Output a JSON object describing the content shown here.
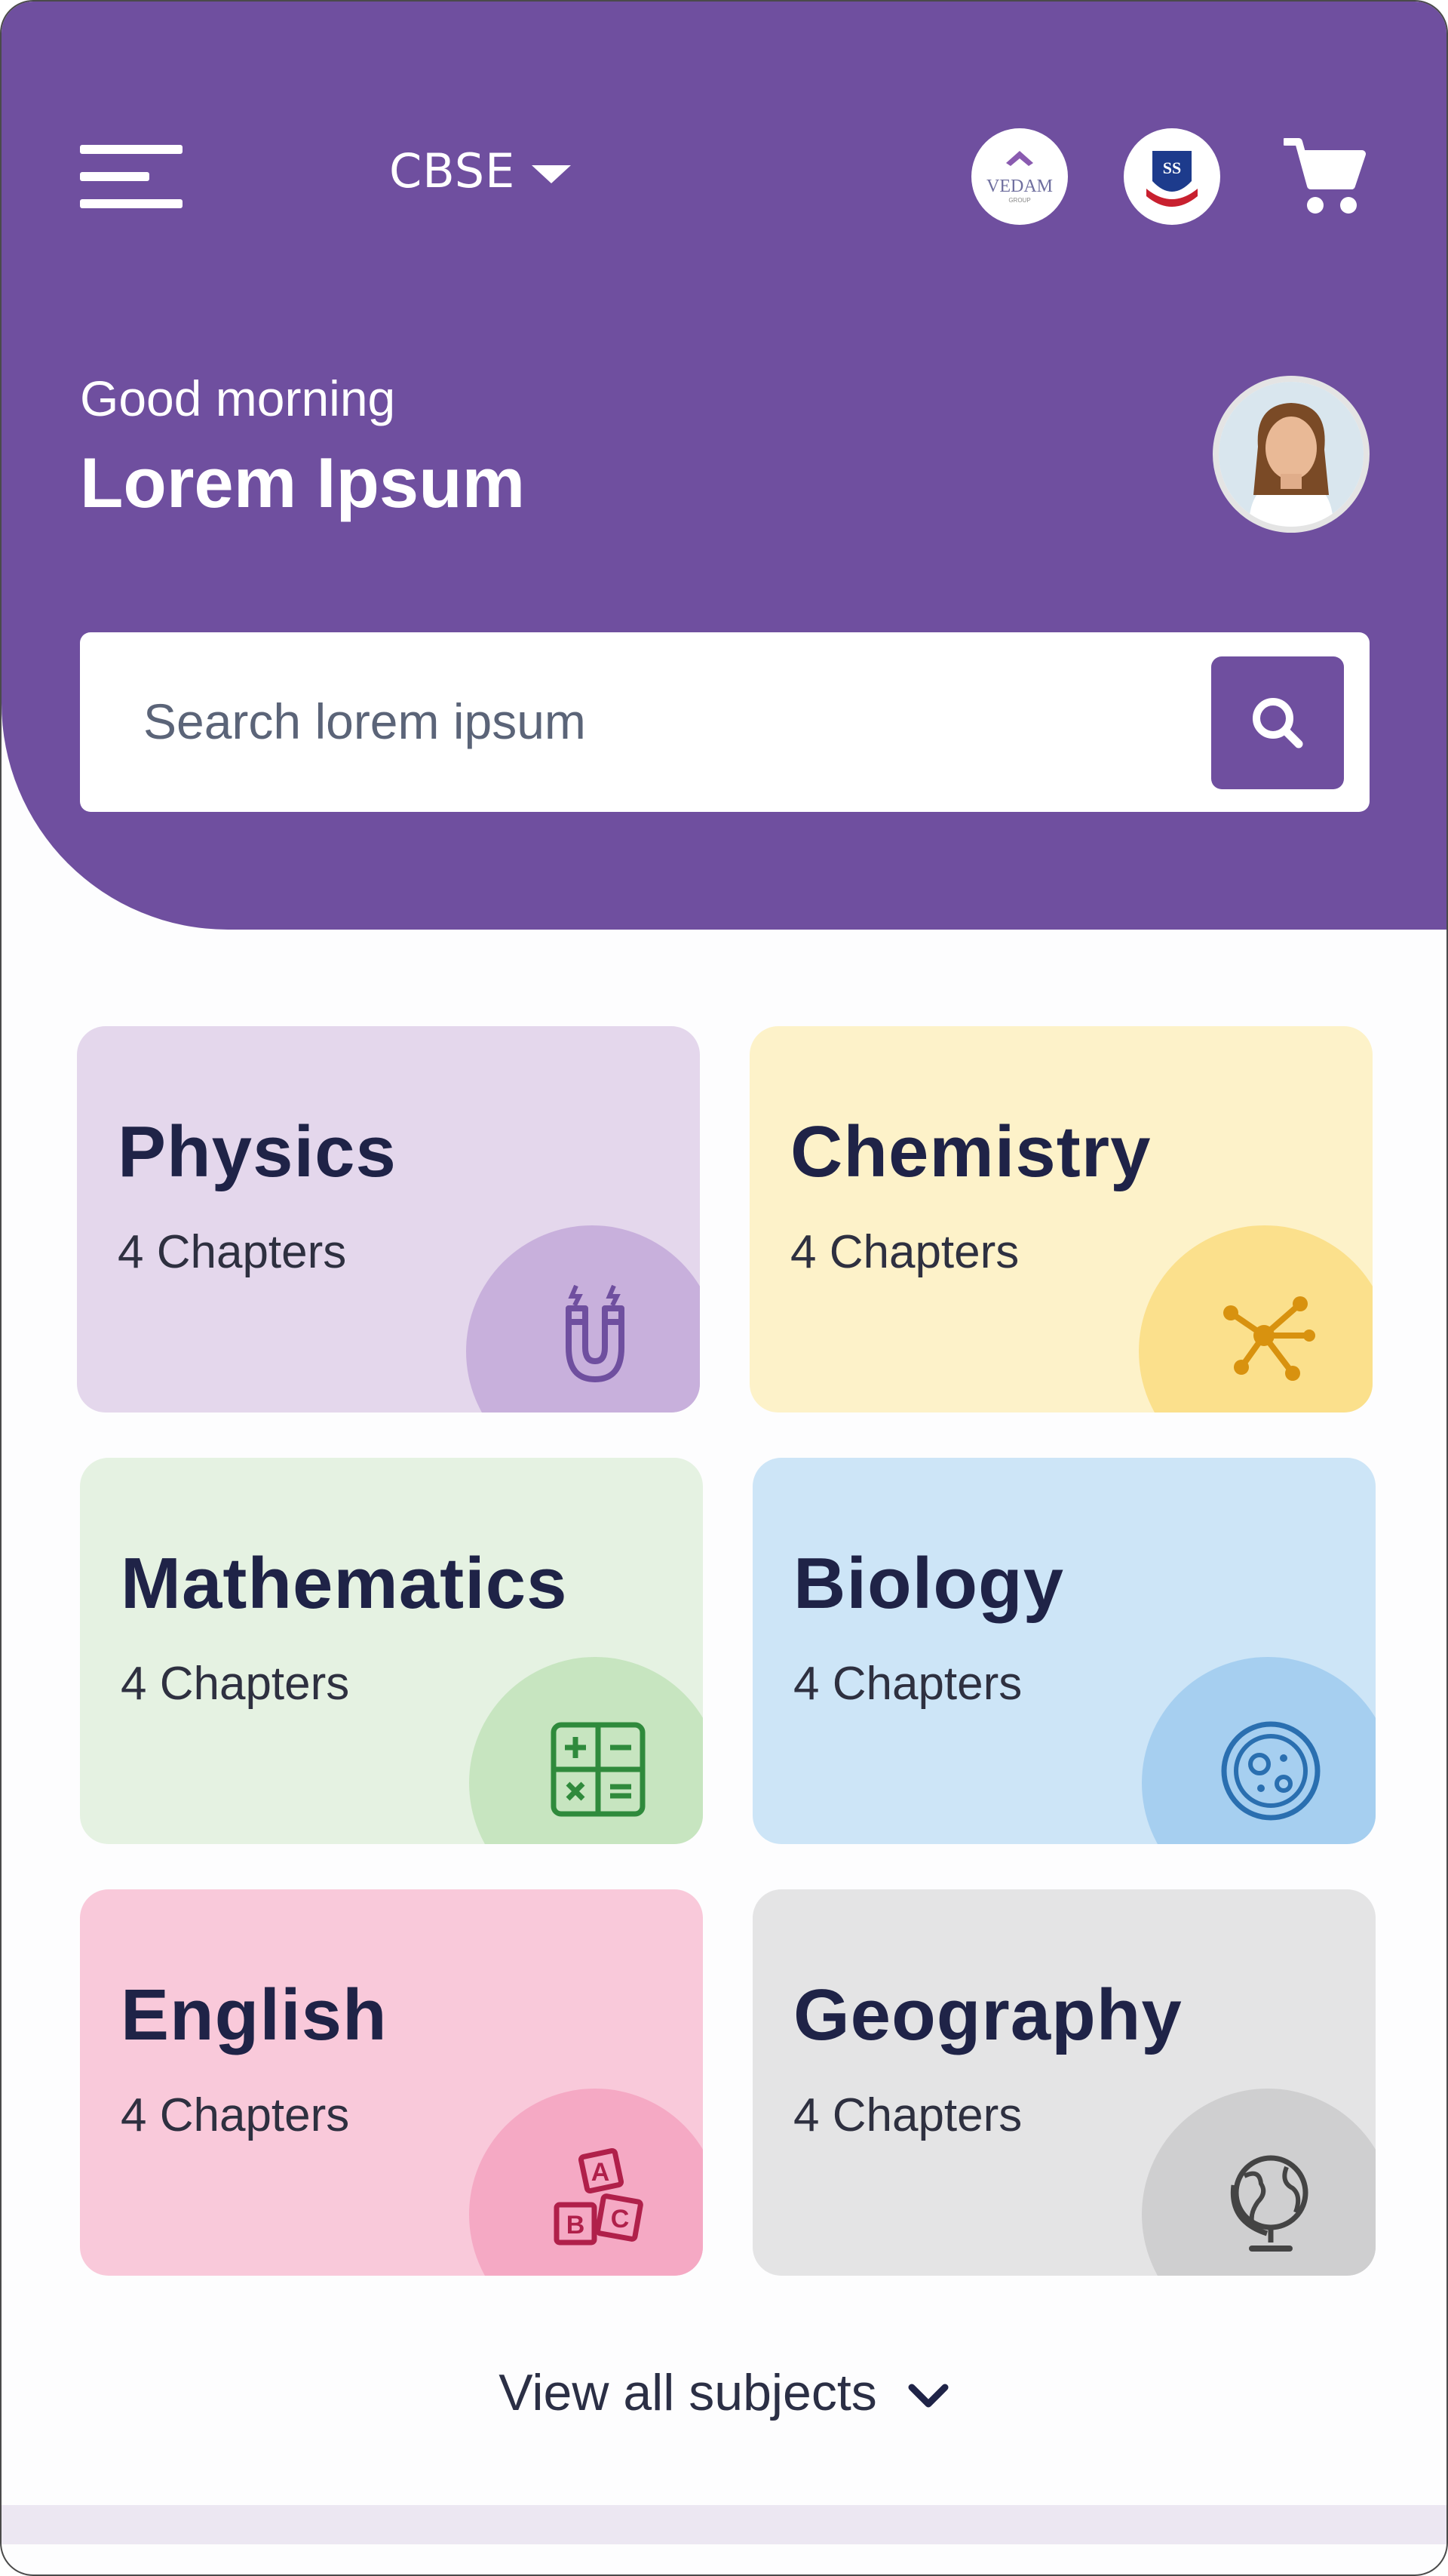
{
  "header": {
    "board": "CBSE",
    "greeting": "Good morning",
    "username": "Lorem Ipsum",
    "partner_logo_1": "VEDAM",
    "partner_logo_1_sub": "GROUP",
    "partner_logo_2": "SS"
  },
  "search": {
    "placeholder": "Search lorem ipsum"
  },
  "subjects": [
    {
      "name": "Physics",
      "chapters": "4 Chapters",
      "icon": "magnet-icon",
      "bg": "#e4d7ec",
      "blob": "#c8b0dc",
      "icon_color": "#6f4f9f"
    },
    {
      "name": "Chemistry",
      "chapters": "4 Chapters",
      "icon": "molecule-icon",
      "bg": "#fdf2c9",
      "blob": "#fbe08c",
      "icon_color": "#d8920f"
    },
    {
      "name": "Mathematics",
      "chapters": "4 Chapters",
      "icon": "calculator-icon",
      "bg": "#e5f2e2",
      "blob": "#c7e5c0",
      "icon_color": "#2f8a3c"
    },
    {
      "name": "Biology",
      "chapters": "4 Chapters",
      "icon": "cell-icon",
      "bg": "#cde5f7",
      "blob": "#a6cff0",
      "icon_color": "#2a6fb0"
    },
    {
      "name": "English",
      "chapters": "4 Chapters",
      "icon": "abc-blocks-icon",
      "bg": "#f9c9da",
      "blob": "#f5a9c4",
      "icon_color": "#b0204a"
    },
    {
      "name": "Geography",
      "chapters": "4 Chapters",
      "icon": "globe-icon",
      "bg": "#e4e4e5",
      "blob": "#cfcfd0",
      "icon_color": "#444444"
    }
  ],
  "view_all": "View all subjects",
  "colors": {
    "primary": "#6f4f9f",
    "title": "#1f2347"
  }
}
